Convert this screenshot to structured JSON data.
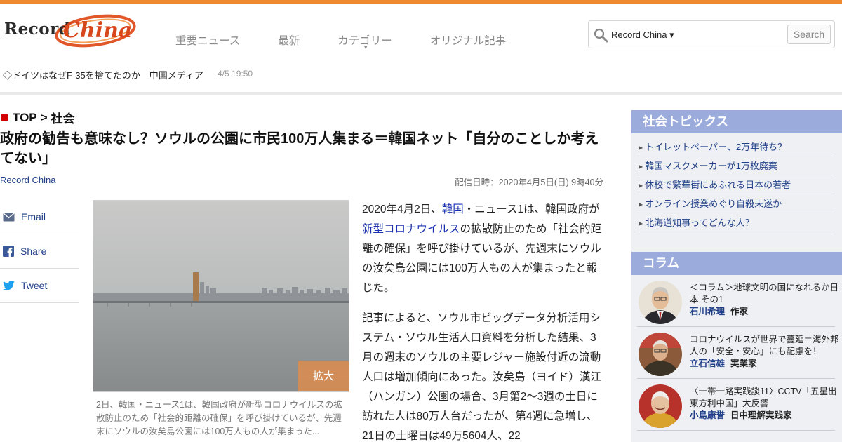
{
  "header": {
    "logo_text_record": "Record",
    "logo_text_china": "China",
    "nav": [
      "重要ニュース",
      "最新",
      "カテゴリー",
      "オリジナル記事"
    ],
    "search": {
      "scope": "Record China ▾",
      "placeholder": "",
      "button": "Search"
    },
    "ticker": {
      "text": "◇ドイツはなぜF-35を捨てたのか―中国メディア",
      "time": "4/5 19:50"
    }
  },
  "breadcrumb": {
    "top": "TOP",
    "separator": ">",
    "section": "社会"
  },
  "article": {
    "title": "政府の勧告も意味なし？ソウルの公園に市民100万人集まる＝韓国ネット「自分のことしか考えてない」",
    "source": "Record China",
    "published": "配信日時：2020年4月5日(日) 9時40分",
    "share": [
      "Email",
      "Share",
      "Tweet"
    ],
    "enlarge_label": "拡大",
    "caption": "2日、韓国・ニュース1は、韓国政府が新型コロナウイルスの拡散防止のため「社会的距離の確保」を呼び掛けているが、先週末にソウルの汝矣島公園には100万人もの人が集まった...",
    "p1": {
      "before": "2020年4月2日、",
      "link1": "韓国",
      "middle": "・ニュース1は、韓国政府が",
      "link2": "新型コロナウイルス",
      "after": "の拡散防止のため「社会的距離の確保」を呼び掛けているが、先週末にソウルの汝矣島公園には100万人もの人が集まったと報じた。"
    },
    "p2": "記事によると、ソウル市ビッグデータ分析活用システム・ソウル生活人口資料を分析した結果、3月の週末のソウルの主要レジャー施設付近の流動人口は増加傾向にあった。汝矣島（ヨイド）漢江（ハンガン）公園の場合、3月第2～3週の土日に訪れた人は80万人台だったが、第4週に急増し、21日の土曜日は49万5604人、22"
  },
  "sidebar": {
    "topics_title": "社会トピックス",
    "topics": [
      "トイレットペーパー、2万年待ち？",
      "韓国マスクメーカーが1万枚廃棄",
      "休校で繁華街にあふれる日本の若者",
      "オンライン授業めぐり自殺未遂か",
      "北海道知事ってどんな人？"
    ],
    "column_title": "コラム",
    "columns": [
      {
        "title": "＜コラム＞地球文明の国になれるか日本 その1",
        "author": "石川希理",
        "role": "作家"
      },
      {
        "title": "コロナウイルスが世界で蔓延＝海外邦人の「安全・安心」にも配慮を！",
        "author": "立石信雄",
        "role": "実業家"
      },
      {
        "title": "〈一帯一路実践談11〉CCTV「五星出東方利中国」大反響",
        "author": "小島康誉",
        "role": "日中理解実践家"
      }
    ]
  },
  "colors": {
    "accent_orange": "#f0882e",
    "link_blue": "#1f3f88",
    "sidebar_header": "#9aabdc",
    "crumb_red": "#d40000"
  }
}
